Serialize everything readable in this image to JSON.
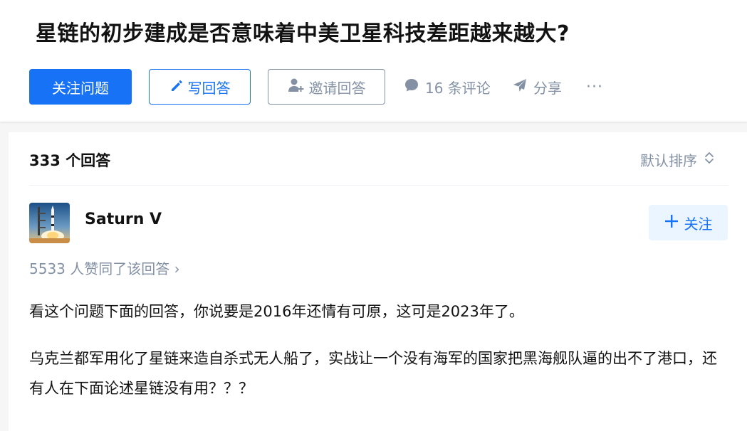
{
  "question": {
    "title": "星链的初步建成是否意味着中美卫星科技差距越来越大?",
    "follow_label": "关注问题",
    "write_answer_label": "写回答",
    "invite_label": "邀请回答",
    "comments_label": "16 条评论",
    "share_label": "分享",
    "more_label": "···"
  },
  "answers": {
    "count_label": "333 个回答",
    "sort_label": "默认排序"
  },
  "answer": {
    "author_name": "Saturn V",
    "follow_label": "关注",
    "upvote_text": "5533 人赞同了该回答 ›",
    "paragraphs": [
      "看这个问题下面的回答，你说要是2016年还情有可原，这可是2023年了。",
      "乌克兰都军用化了星链来造自杀式无人船了，实战让一个没有海军的国家把黑海舰队逼的出不了港口，还有人在下面论述星链没有用？？？"
    ]
  },
  "icons": {
    "write": "pencil-icon",
    "invite": "add-person-icon",
    "comments": "comment-bubble-icon",
    "share": "paper-plane-icon",
    "sort": "sort-updown-icon",
    "follow": "plus-icon"
  },
  "colors": {
    "accent": "#1772f6",
    "muted": "#8491a5",
    "text": "#121212",
    "follow_bg": "#ebf5ff"
  }
}
